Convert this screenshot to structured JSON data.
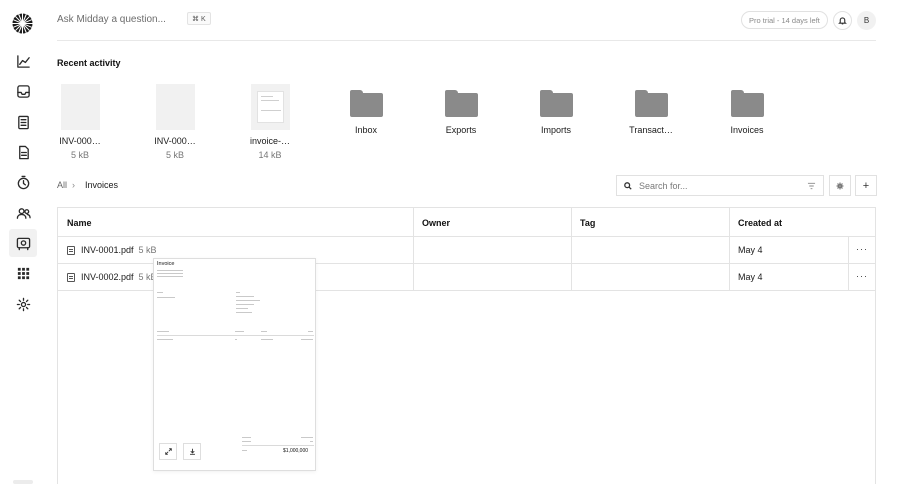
{
  "header": {
    "ask_placeholder": "Ask Midday a question...",
    "shortcut": "⌘ K",
    "trial_label": "Pro trial - 14 days left",
    "avatar_initial": "B"
  },
  "sidebar": {
    "items": [
      {
        "icon": "chart-icon"
      },
      {
        "icon": "inbox-icon"
      },
      {
        "icon": "transactions-icon"
      },
      {
        "icon": "invoice-icon"
      },
      {
        "icon": "tracker-icon"
      },
      {
        "icon": "customers-icon"
      },
      {
        "icon": "vault-icon",
        "active": true
      },
      {
        "icon": "apps-icon"
      },
      {
        "icon": "settings-icon"
      }
    ]
  },
  "recent": {
    "title": "Recent activity",
    "files": [
      {
        "name": "INV-000…",
        "size": "5 kB"
      },
      {
        "name": "INV-000…",
        "size": "5 kB"
      },
      {
        "name": "invoice-…",
        "size": "14 kB"
      }
    ],
    "folders": [
      "Inbox",
      "Exports",
      "Imports",
      "Transact…",
      "Invoices"
    ]
  },
  "breadcrumb": {
    "root": "All",
    "separator": "›",
    "current": "Invoices"
  },
  "search": {
    "placeholder": "Search for..."
  },
  "toolbar": {
    "add_label": "+"
  },
  "table": {
    "columns": [
      "Name",
      "Owner",
      "Tag",
      "Created at"
    ],
    "rows": [
      {
        "name": "INV-0001.pdf",
        "size": "5 kB",
        "created": "May 4",
        "more": "···"
      },
      {
        "name": "INV-0002.pdf",
        "size": "5 kB",
        "created": "May 4",
        "more": "···"
      }
    ]
  },
  "preview": {
    "doc_title": "Invoice",
    "total": "$1,000,000"
  }
}
